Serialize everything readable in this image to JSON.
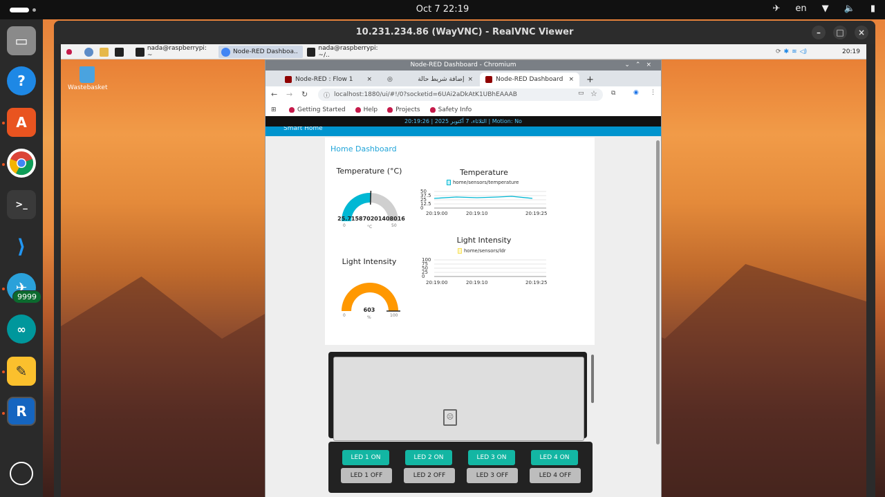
{
  "topbar": {
    "datetime": "Oct 7  22:19",
    "lang": "en"
  },
  "dock": {
    "badge_count": "9999"
  },
  "vnc": {
    "title": "10.231.234.86 (WayVNC) - RealVNC Viewer"
  },
  "remote": {
    "taskbar": {
      "task1": "nada@raspberrypi: ~",
      "task2": "Node-RED Dashboa..",
      "task3": "nada@raspberrypi: ~/..",
      "time": "20:19"
    },
    "desktop_icon": "Wastebasket"
  },
  "chromium": {
    "title": "Node-RED Dashboard - Chromium",
    "tabs": [
      "Node-RED : Flow 1",
      "إضافة شريط حالة",
      "Node-RED Dashboard"
    ],
    "url": "localhost:1880/ui/#!/0?socketid=6UAi2aDkAtK1UBhEAAAB",
    "bookmarks": [
      "Getting Started",
      "Help",
      "Projects",
      "Safety Info"
    ]
  },
  "dashboard": {
    "status": "20:19:26 | الثلاثاء، 7 أكتوبر 2025 | Motion: No",
    "header": "Smart Home",
    "group": "Home Dashboard",
    "temp_gauge": {
      "title": "Temperature (°C)",
      "value": "25.715870201408016",
      "unit": "°C",
      "min": "0",
      "max": "50",
      "fraction": 0.51
    },
    "light_gauge": {
      "title": "Light Intensity",
      "value": "603",
      "unit": "%",
      "min": "0",
      "max": "100",
      "fraction": 1.0
    },
    "temp_chart": {
      "title": "Temperature",
      "legend": "home/sensors/temperature",
      "yticks": [
        "50",
        "37.5",
        "25",
        "12.5",
        "0"
      ],
      "xticks": [
        "20:19:00",
        "20:19:10",
        "20:19:25"
      ]
    },
    "light_chart": {
      "title": "Light Intensity",
      "legend": "home/sensors/ldr",
      "yticks": [
        "100",
        "75",
        "50",
        "25",
        "0"
      ],
      "xticks": [
        "20:19:00",
        "20:19:10",
        "20:19:25"
      ]
    },
    "leds": [
      {
        "on": "LED 1 ON",
        "off": "LED 1 OFF"
      },
      {
        "on": "LED 2 ON",
        "off": "LED 2 OFF"
      },
      {
        "on": "LED 3 ON",
        "off": "LED 3 OFF"
      },
      {
        "on": "LED 4 ON",
        "off": "LED 4 OFF"
      }
    ]
  },
  "colors": {
    "accent": "#0094ce",
    "teal": "#13b6a3",
    "gauge_temp": "#00b8d4",
    "gauge_light": "#ff9800"
  }
}
